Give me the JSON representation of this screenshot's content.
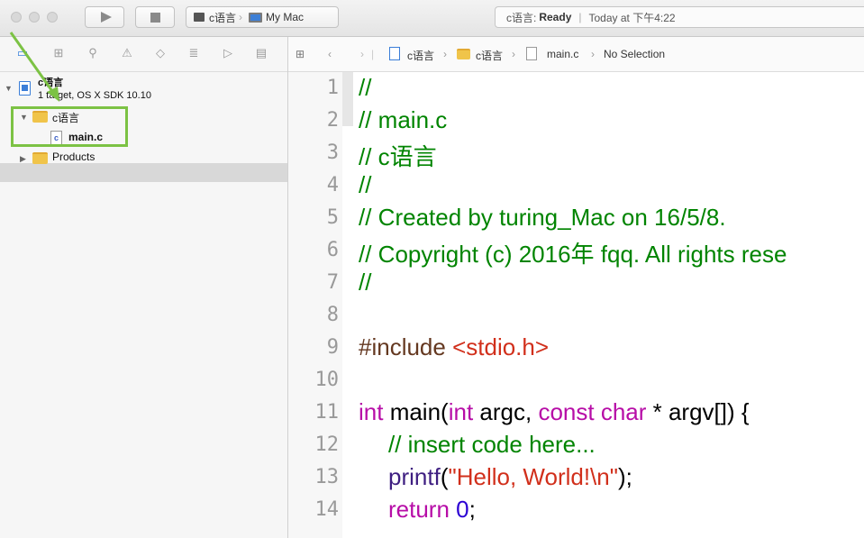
{
  "toolbar": {
    "scheme_target": "c语言",
    "scheme_device": "My Mac",
    "status_project": "c语言:",
    "status_state": "Ready",
    "status_time": "Today at 下午4:22"
  },
  "navigator": {
    "project_name": "c语言",
    "project_subtitle": "1 target, OS X SDK 10.10",
    "group_name": "c语言",
    "file_name": "main.c",
    "products_label": "Products"
  },
  "jump_bar": {
    "crumbs": [
      "c语言",
      "c语言",
      "main.c",
      "No Selection"
    ]
  },
  "editor": {
    "line_numbers": [
      "1",
      "2",
      "3",
      "4",
      "5",
      "6",
      "7",
      "8",
      "9",
      "10",
      "11",
      "12",
      "13",
      "14"
    ],
    "code": {
      "l1": "//",
      "l2": "//  main.c",
      "l3": "//  c语言",
      "l4": "//",
      "l5": "//  Created by turing_Mac on 16/5/8.",
      "l6": "//  Copyright (c) 2016年 fqq. All rights rese",
      "l7": "//",
      "l9_pp": "#include ",
      "l9_str": "<stdio.h>",
      "l11_kw1": "int",
      "l11_t1": " main(",
      "l11_kw2": "int",
      "l11_t2": " argc, ",
      "l11_kw3": "const",
      "l11_t3": " ",
      "l11_kw4": "char",
      "l11_t4": " * argv[]) {",
      "l12": "// insert code here...",
      "l13_fn": "printf",
      "l13_t1": "(",
      "l13_str": "\"Hello, World!\\n\"",
      "l13_t2": ");",
      "l14_kw": "return",
      "l14_t1": " ",
      "l14_num": "0",
      "l14_t2": ";"
    }
  },
  "colors": {
    "comment": "#008400",
    "keyword": "#b70da7",
    "string": "#d12f1b",
    "annotation": "#7cc244"
  }
}
